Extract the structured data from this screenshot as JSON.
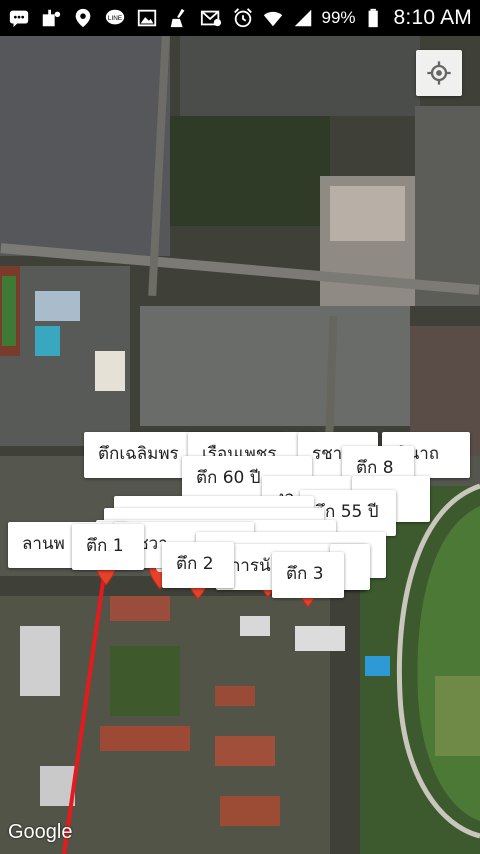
{
  "status_bar": {
    "battery_percent": "99%",
    "time": "8:10 AM",
    "icons": [
      "chat-icon",
      "notification-icon",
      "location-icon",
      "line-icon",
      "gallery-icon",
      "cleaner-icon",
      "email-icon",
      "alarm-icon",
      "wifi-icon",
      "signal-icon",
      "battery-icon"
    ]
  },
  "map": {
    "attribution": "Google",
    "locate_button_icon": "my-location-icon",
    "route_color": "#e8191c",
    "marker_color": "#e8412a",
    "labels": [
      {
        "text": "ตึกเฉลิมพร"
      },
      {
        "text": "เรือนเพชร"
      },
      {
        "text": "รชา"
      },
      {
        "text": "ตึก 8"
      },
      {
        "text": "นินาถ"
      },
      {
        "text": "ตึก 60 ปี"
      },
      {
        "text": "งอ"
      },
      {
        "text": "ตึก 55 ปี"
      },
      {
        "text": "อง"
      },
      {
        "text": "ลานพ"
      },
      {
        "text": "ตึก 1"
      },
      {
        "text": "รัชวา"
      },
      {
        "text": "ตึก 2"
      },
      {
        "text": "การนั"
      },
      {
        "text": "ร"
      },
      {
        "text": "ตึก 3"
      }
    ]
  }
}
